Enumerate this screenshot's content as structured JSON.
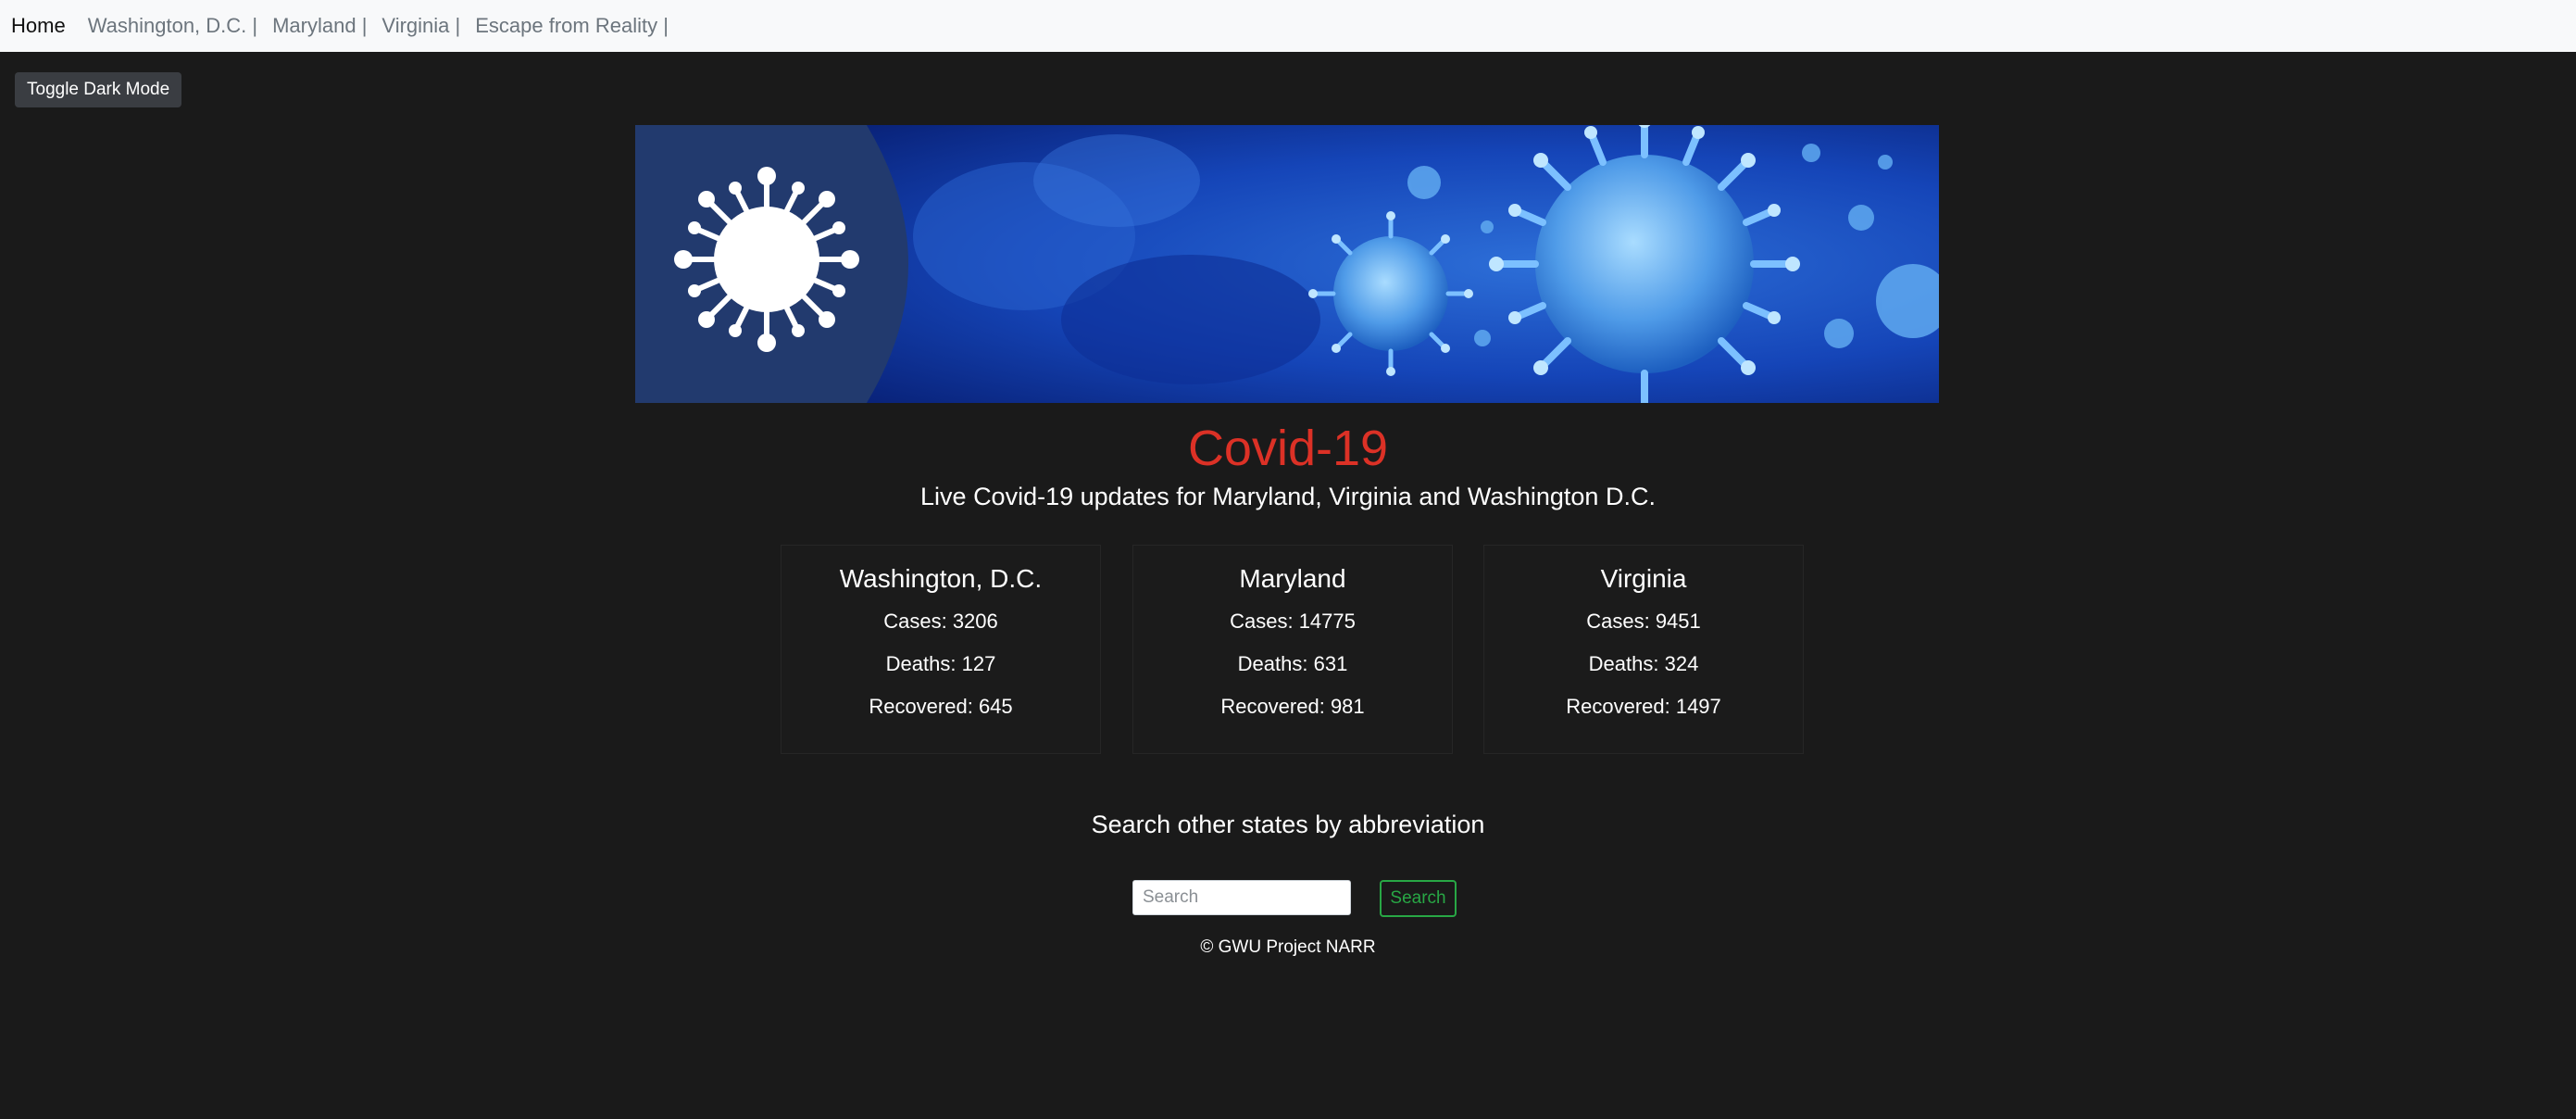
{
  "nav": {
    "home": "Home",
    "links": [
      "Washington, D.C. |",
      "Maryland |",
      "Virginia |",
      "Escape from Reality |"
    ]
  },
  "toggle_label": "Toggle Dark Mode",
  "banner": {
    "icon": "virus-icon"
  },
  "title": "Covid-19",
  "subtitle": "Live Covid-19 updates for Maryland, Virginia and Washington D.C.",
  "cards": [
    {
      "name": "Washington, D.C.",
      "cases": "Cases: 3206",
      "deaths": "Deaths: 127",
      "recovered": "Recovered: 645"
    },
    {
      "name": "Maryland",
      "cases": "Cases: 14775",
      "deaths": "Deaths: 631",
      "recovered": "Recovered: 981"
    },
    {
      "name": "Virginia",
      "cases": "Cases: 9451",
      "deaths": "Deaths: 324",
      "recovered": "Recovered: 1497"
    }
  ],
  "search": {
    "heading": "Search other states by abbreviation",
    "placeholder": "Search",
    "button_label": "Search"
  },
  "footer": "© GWU Project NARR",
  "colors": {
    "background": "#1a1a1a",
    "title": "#dc3126",
    "search_button": "#28a745",
    "navbar": "#f8f9fa"
  }
}
